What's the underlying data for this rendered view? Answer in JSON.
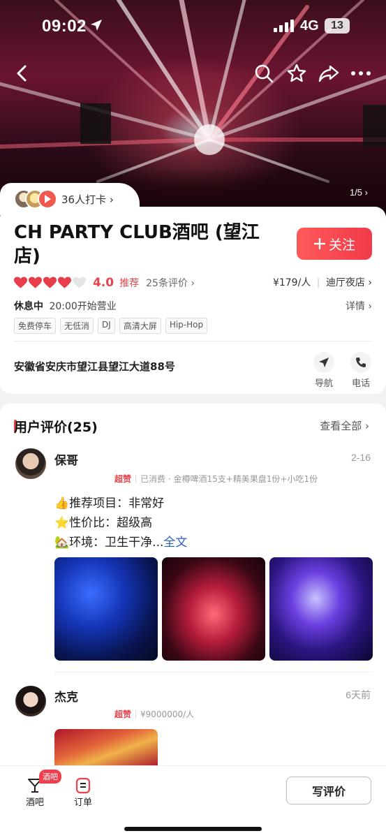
{
  "status_bar": {
    "time": "09:02",
    "network": "4G",
    "battery": "13"
  },
  "hero": {
    "counter": "1/5"
  },
  "checkin": {
    "label": "36人打卡"
  },
  "shop": {
    "title": "CH PARTY CLUB酒吧 (望江店)",
    "follow_label": "关注",
    "score": "4.0",
    "recommend": "推荐",
    "reviews_count": "25条评价",
    "price": "¥179/人",
    "category": "迪厅夜店",
    "status": "休息中",
    "open_time": "20:00开始营业",
    "detail_label": "详情",
    "tags": [
      "免费停车",
      "无低消",
      "DJ",
      "高清大屏",
      "Hip-Hop"
    ],
    "address": "安徽省安庆市望江县望江大道88号",
    "nav_label": "导航",
    "phone_label": "电话"
  },
  "reviews_section": {
    "title": "用户评价(25)",
    "view_all": "查看全部",
    "items": [
      {
        "name": "保哥",
        "date": "2-16",
        "rating_label": "超赞",
        "consumption": "已消费 · 金樽啤酒15支+精美果盘1份+小吃1份",
        "lines": [
          "推荐项目：非常好",
          "性价比：超级高",
          "环境：卫生干净..."
        ],
        "more_label": "全文"
      },
      {
        "name": "杰克",
        "date": "6天前",
        "rating_label": "超赞",
        "consumption": "¥9000000/人"
      }
    ]
  },
  "bottom_bar": {
    "tab_bar": "酒吧",
    "tab_bar_badge": "酒吧",
    "tab_orders": "订单",
    "write_review": "写评价"
  },
  "colors": {
    "accent": "#e8444c",
    "link": "#2b5fb8"
  }
}
